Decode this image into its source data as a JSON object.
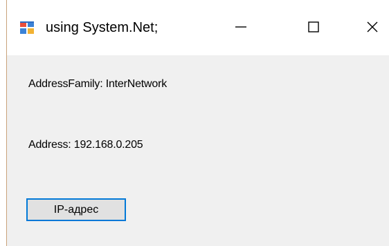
{
  "window": {
    "title": "using System.Net;",
    "controls": {
      "minimize": "minimize",
      "maximize": "maximize",
      "close": "close"
    }
  },
  "form": {
    "address_family_label": "AddressFamily: InterNetwork",
    "address_label": "Address: 192.168.0.205",
    "ip_button_label": "IP-адрес"
  },
  "colors": {
    "accent_border": "#0078d7",
    "button_face": "#e1e1e1",
    "client_bg": "#f0f0f0"
  }
}
